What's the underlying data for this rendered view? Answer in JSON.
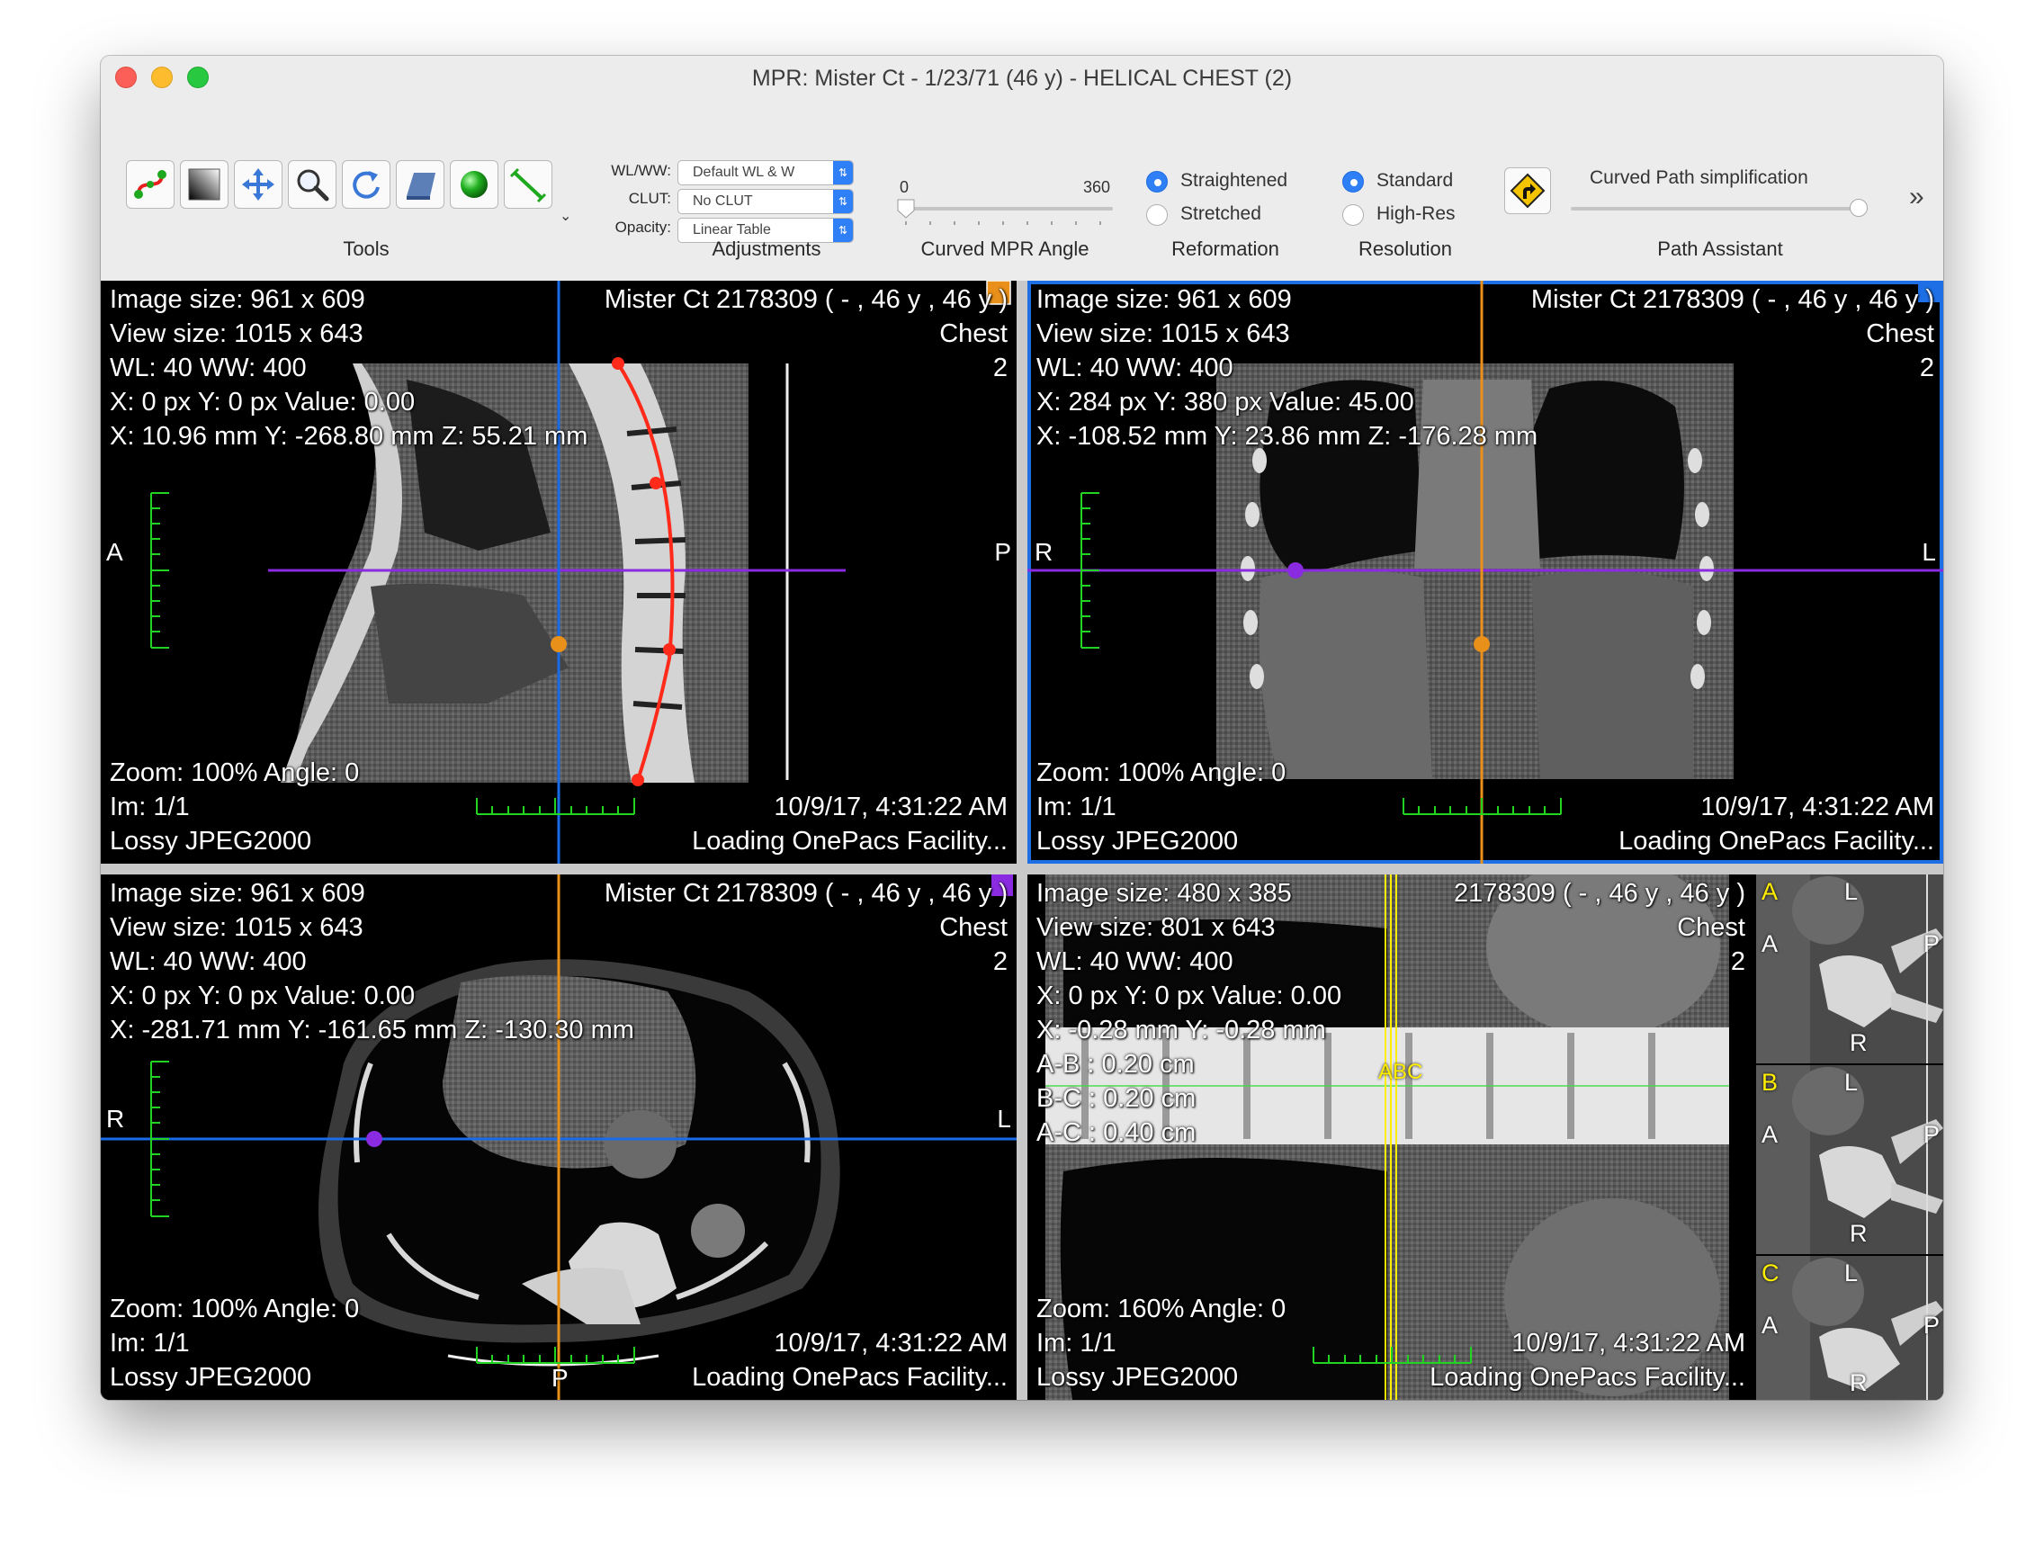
{
  "window": {
    "title": "MPR: Mister Ct - 1/23/71 (46 y) - HELICAL CHEST (2)"
  },
  "toolbar": {
    "groups": {
      "tools": "Tools",
      "adjustments": "Adjustments",
      "curved_angle": "Curved MPR Angle",
      "reformation": "Reformation",
      "resolution": "Resolution",
      "path_assistant": "Path Assistant"
    },
    "tools": [
      "curved-path-icon",
      "window-level-icon",
      "move-icon",
      "zoom-icon",
      "rotate-icon",
      "thickness-icon",
      "3d-point-icon",
      "ruler-icon"
    ],
    "wlww": {
      "label": "WL/WW:",
      "value": "Default WL & W"
    },
    "clut": {
      "label": "CLUT:",
      "value": "No CLUT"
    },
    "opacity": {
      "label": "Opacity:",
      "value": "Linear Table"
    },
    "angle": {
      "min": "0",
      "max": "360",
      "value": 0
    },
    "reformation": {
      "opt1": "Straightened",
      "opt2": "Stretched",
      "selected": "Straightened"
    },
    "resolution": {
      "opt1": "Standard",
      "opt2": "High-Res",
      "selected": "Standard"
    },
    "path_assistant": {
      "label": "Curved Path simplification",
      "value": 1.0
    },
    "overflow": "»"
  },
  "viewports": {
    "sagittal": {
      "tl": [
        "Image size: 961 x 609",
        "View size: 1015 x 643",
        "WL: 40 WW: 400",
        "X: 0 px Y: 0 px Value: 0.00",
        "X: 10.96 mm Y: -268.80 mm Z: 55.21 mm"
      ],
      "tr": [
        "Mister Ct 2178309 (  - ,  46 y ,  46 y )",
        "Chest",
        "2"
      ],
      "bl": [
        "Zoom: 100% Angle: 0",
        "Im: 1/1",
        "Lossy JPEG2000"
      ],
      "br": [
        "10/9/17, 4:31:22 AM",
        "Loading OnePacs Facility..."
      ],
      "left": "A",
      "right": "P"
    },
    "coronal": {
      "tl": [
        "Image size: 961 x 609",
        "View size: 1015 x 643",
        "WL: 40 WW: 400",
        "X: 284 px Y: 380 px Value: 45.00",
        "X: -108.52 mm Y: 23.86 mm Z: -176.28 mm"
      ],
      "tr": [
        "Mister Ct 2178309 (  - ,  46 y ,  46 y )",
        "Chest",
        "2"
      ],
      "bl": [
        "Zoom: 100% Angle: 0",
        "Im: 1/1",
        "Lossy JPEG2000"
      ],
      "br": [
        "10/9/17, 4:31:22 AM",
        "Loading OnePacs Facility..."
      ],
      "left": "R",
      "right": "L"
    },
    "axial": {
      "tl": [
        "Image size: 961 x 609",
        "View size: 1015 x 643",
        "WL: 40 WW: 400",
        "X: 0 px Y: 0 px Value: 0.00",
        "X: -281.71 mm Y: -161.65 mm Z: -130.30 mm"
      ],
      "tr": [
        "Mister Ct 2178309 (  - ,  46 y ,  46 y )",
        "Chest",
        "2"
      ],
      "bl": [
        "Zoom: 100% Angle: 0",
        "Im: 1/1",
        "Lossy JPEG2000"
      ],
      "br": [
        "10/9/17, 4:31:22 AM",
        "Loading OnePacs Facility..."
      ],
      "left": "R",
      "right": "L",
      "bottom": "P"
    },
    "curved": {
      "tl": [
        "Image size: 480 x 385",
        "View size: 801 x 643",
        "WL: 40 WW: 400",
        "X: 0 px Y: 0 px Value: 0.00",
        "X: -0.28 mm Y: -0.28 mm",
        "A-B : 0.20 cm",
        "B-C : 0.20 cm",
        "A-C : 0.40 cm"
      ],
      "tr": [
        "2178309 (  - ,  46 y ,  46 y )",
        "Chest",
        "2"
      ],
      "bl": [
        "Zoom: 160% Angle: 0",
        "Im: 1/1",
        "Lossy JPEG2000"
      ],
      "br": [
        "10/9/17, 4:31:22 AM",
        "Loading OnePacs Facility..."
      ],
      "marker": "ABC"
    },
    "thumbnails": [
      {
        "letter": "A",
        "top": "L",
        "left": "A",
        "right": "P",
        "bottom": "R"
      },
      {
        "letter": "B",
        "top": "L",
        "left": "A",
        "right": "P",
        "bottom": "R"
      },
      {
        "letter": "C",
        "top": "L",
        "left": "A",
        "right": "P",
        "bottom": "R"
      }
    ]
  },
  "colors": {
    "accent": "#1e6fe6",
    "crosshair_blue": "#1a6be8",
    "crosshair_orange": "#e8901a",
    "crosshair_purple": "#8a2be2",
    "path_red": "#ff2a1a",
    "scale_green": "#22d422",
    "marker_yellow": "#ffee00"
  }
}
